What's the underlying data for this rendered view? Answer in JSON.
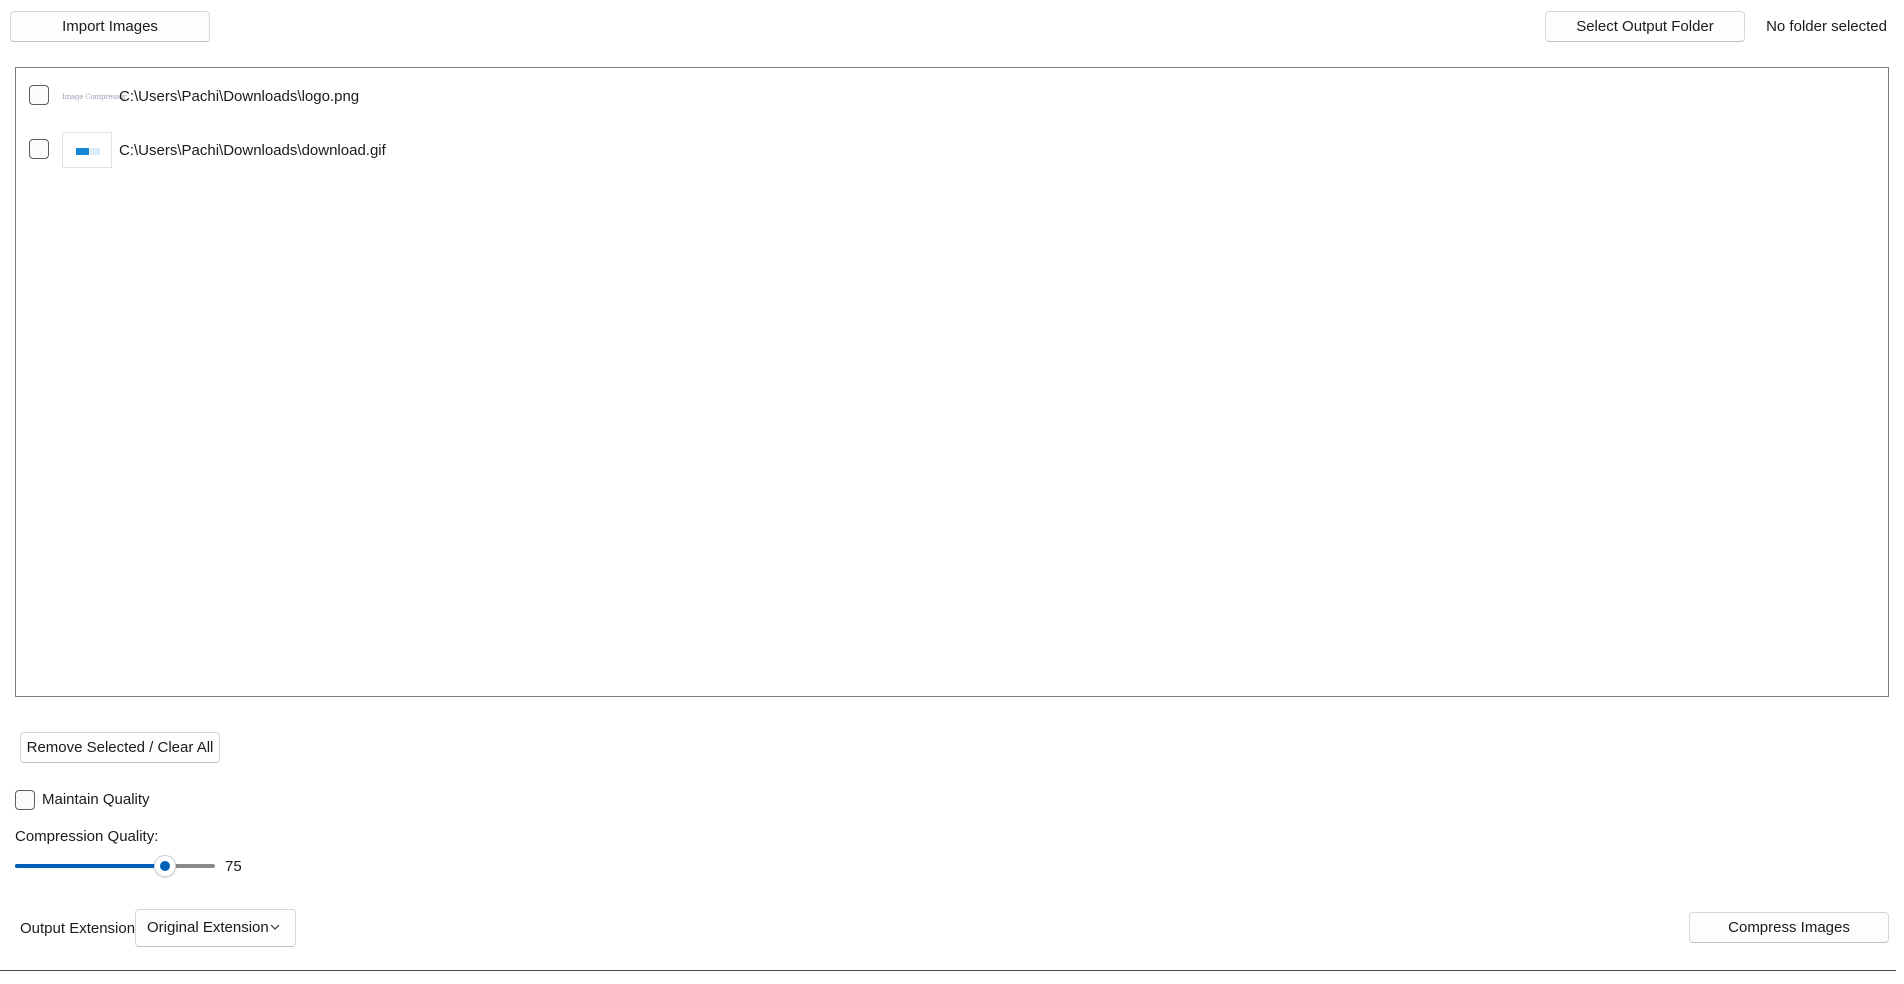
{
  "toolbar": {
    "import_label": "Import Images",
    "select_output_label": "Select Output Folder",
    "folder_status": "No folder selected"
  },
  "file_list": {
    "items": [
      {
        "path": "C:\\Users\\Pachi\\Downloads\\logo.png",
        "thumb_text": "Image Compressor",
        "checked": false
      },
      {
        "path": "C:\\Users\\Pachi\\Downloads\\download.gif",
        "checked": false
      }
    ]
  },
  "actions": {
    "remove_label": "Remove Selected / Clear All",
    "compress_label": "Compress Images"
  },
  "options": {
    "maintain_quality_label": "Maintain Quality",
    "maintain_quality_checked": false,
    "compression_quality_label": "Compression Quality:",
    "quality_value": "75",
    "quality_min": 0,
    "quality_max": 100,
    "output_extension_label": "Output Extension:",
    "output_extension_value": "Original Extension"
  },
  "colors": {
    "accent": "#005fb8"
  }
}
